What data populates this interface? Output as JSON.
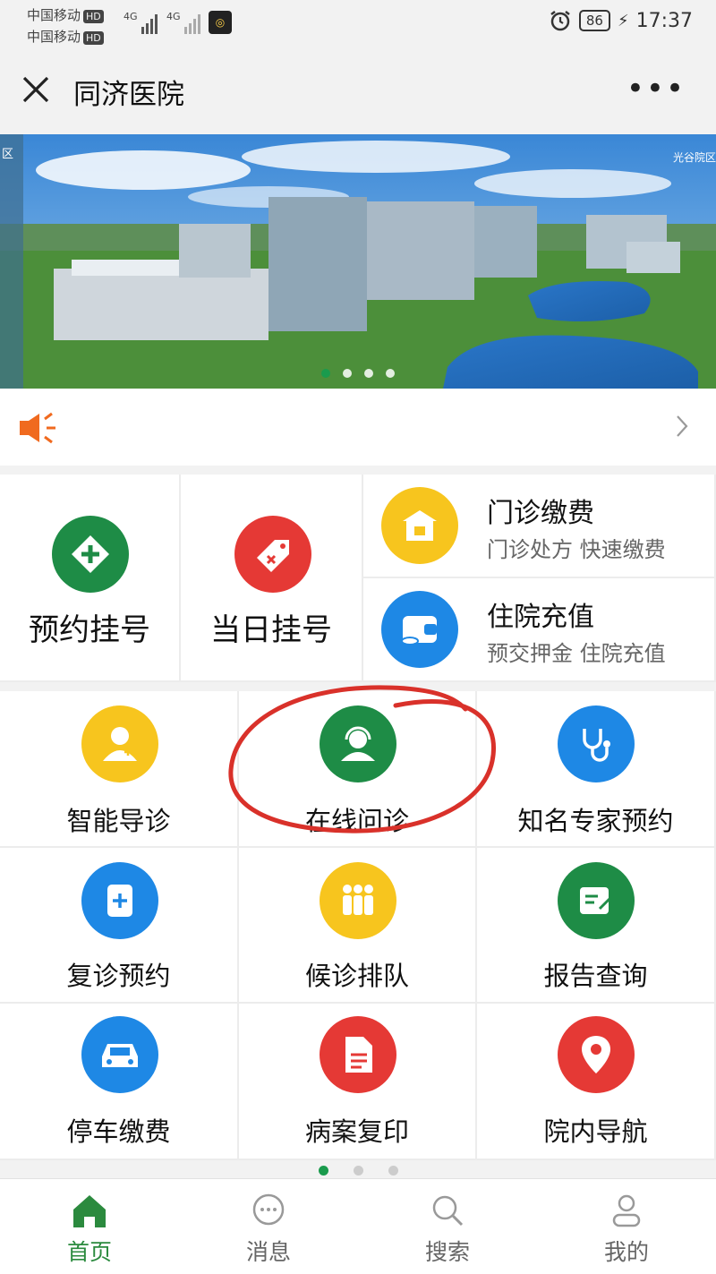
{
  "status_bar": {
    "carrier1": "中国移动",
    "carrier2": "中国移动",
    "hd": "HD",
    "net1": "4G",
    "net2": "4G",
    "battery": "86",
    "time": "17:37"
  },
  "title_bar": {
    "title": "同济医院"
  },
  "banner": {
    "sign_left": "区",
    "sign_right": "光谷院区",
    "active_slide": 1,
    "slide_count": 4
  },
  "notice": {
    "text": ""
  },
  "quick_services": {
    "appointment": "预约挂号",
    "same_day": "当日挂号",
    "outpatient_pay": {
      "title": "门诊缴费",
      "subtitle": "门诊处方 快速缴费"
    },
    "inpatient_recharge": {
      "title": "住院充值",
      "subtitle": "预交押金 住院充值"
    }
  },
  "grid": [
    {
      "label": "智能导诊",
      "icon": "doctor-icon",
      "color": "#f7c51e"
    },
    {
      "label": "在线问诊",
      "icon": "headset-icon",
      "color": "#1e8c46"
    },
    {
      "label": "知名专家预约",
      "icon": "stethoscope-icon",
      "color": "#1e88e5"
    },
    {
      "label": "复诊预约",
      "icon": "notebook-plus-icon",
      "color": "#1e88e5"
    },
    {
      "label": "候诊排队",
      "icon": "queue-people-icon",
      "color": "#f7c51e"
    },
    {
      "label": "报告查询",
      "icon": "report-icon",
      "color": "#1e8c46"
    },
    {
      "label": "停车缴费",
      "icon": "car-icon",
      "color": "#1e88e5"
    },
    {
      "label": "病案复印",
      "icon": "document-icon",
      "color": "#e53935"
    },
    {
      "label": "院内导航",
      "icon": "location-pin-icon",
      "color": "#e53935"
    }
  ],
  "grid_page": {
    "active": 1,
    "count": 3
  },
  "tabs": [
    {
      "label": "首页",
      "active": true
    },
    {
      "label": "消息",
      "active": false
    },
    {
      "label": "搜索",
      "active": false
    },
    {
      "label": "我的",
      "active": false
    }
  ],
  "colors": {
    "brand_green": "#1e8c46",
    "accent_red": "#e53935",
    "yellow": "#f7c51e",
    "blue": "#1e88e5"
  }
}
